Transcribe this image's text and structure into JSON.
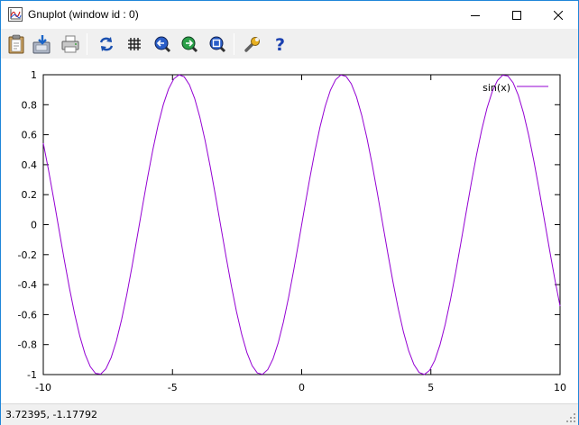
{
  "window": {
    "title": "Gnuplot (window id : 0)"
  },
  "toolbar": {
    "buttons": [
      {
        "name": "copy-clipboard",
        "icon": "clipboard-icon"
      },
      {
        "name": "save",
        "icon": "save-disk-icon"
      },
      {
        "name": "print",
        "icon": "printer-icon"
      },
      {
        "name": "replot",
        "icon": "refresh-icon"
      },
      {
        "name": "grid",
        "icon": "grid-icon"
      },
      {
        "name": "zoom-previous",
        "icon": "zoom-back-icon"
      },
      {
        "name": "zoom-next",
        "icon": "zoom-forward-icon"
      },
      {
        "name": "unzoom",
        "icon": "zoom-reset-icon"
      },
      {
        "name": "options",
        "icon": "wrench-icon"
      },
      {
        "name": "help",
        "icon": "help-icon"
      }
    ]
  },
  "chart_data": {
    "type": "line",
    "function": "sin(x)",
    "series": [
      {
        "name": "sin(x)",
        "color": "#9400d3"
      }
    ],
    "xlim": [
      -10,
      10
    ],
    "ylim": [
      -1,
      1
    ],
    "x_ticks": [
      -10,
      -5,
      0,
      5,
      10
    ],
    "x_tick_labels": [
      "-10",
      "-5",
      "0",
      "5",
      "10"
    ],
    "y_ticks": [
      -1,
      -0.8,
      -0.6,
      -0.4,
      -0.2,
      0,
      0.2,
      0.4,
      0.6,
      0.8,
      1
    ],
    "y_tick_labels": [
      "-1",
      "-0.8",
      "-0.6",
      "-0.4",
      "-0.2",
      "0",
      "0.2",
      "0.4",
      "0.6",
      "0.8",
      "1"
    ],
    "sample_count": 100,
    "grid": false,
    "legend_position": "top-right",
    "title": "",
    "xlabel": "",
    "ylabel": ""
  },
  "statusbar": {
    "coordinates": "3.72395, -1.17792"
  }
}
